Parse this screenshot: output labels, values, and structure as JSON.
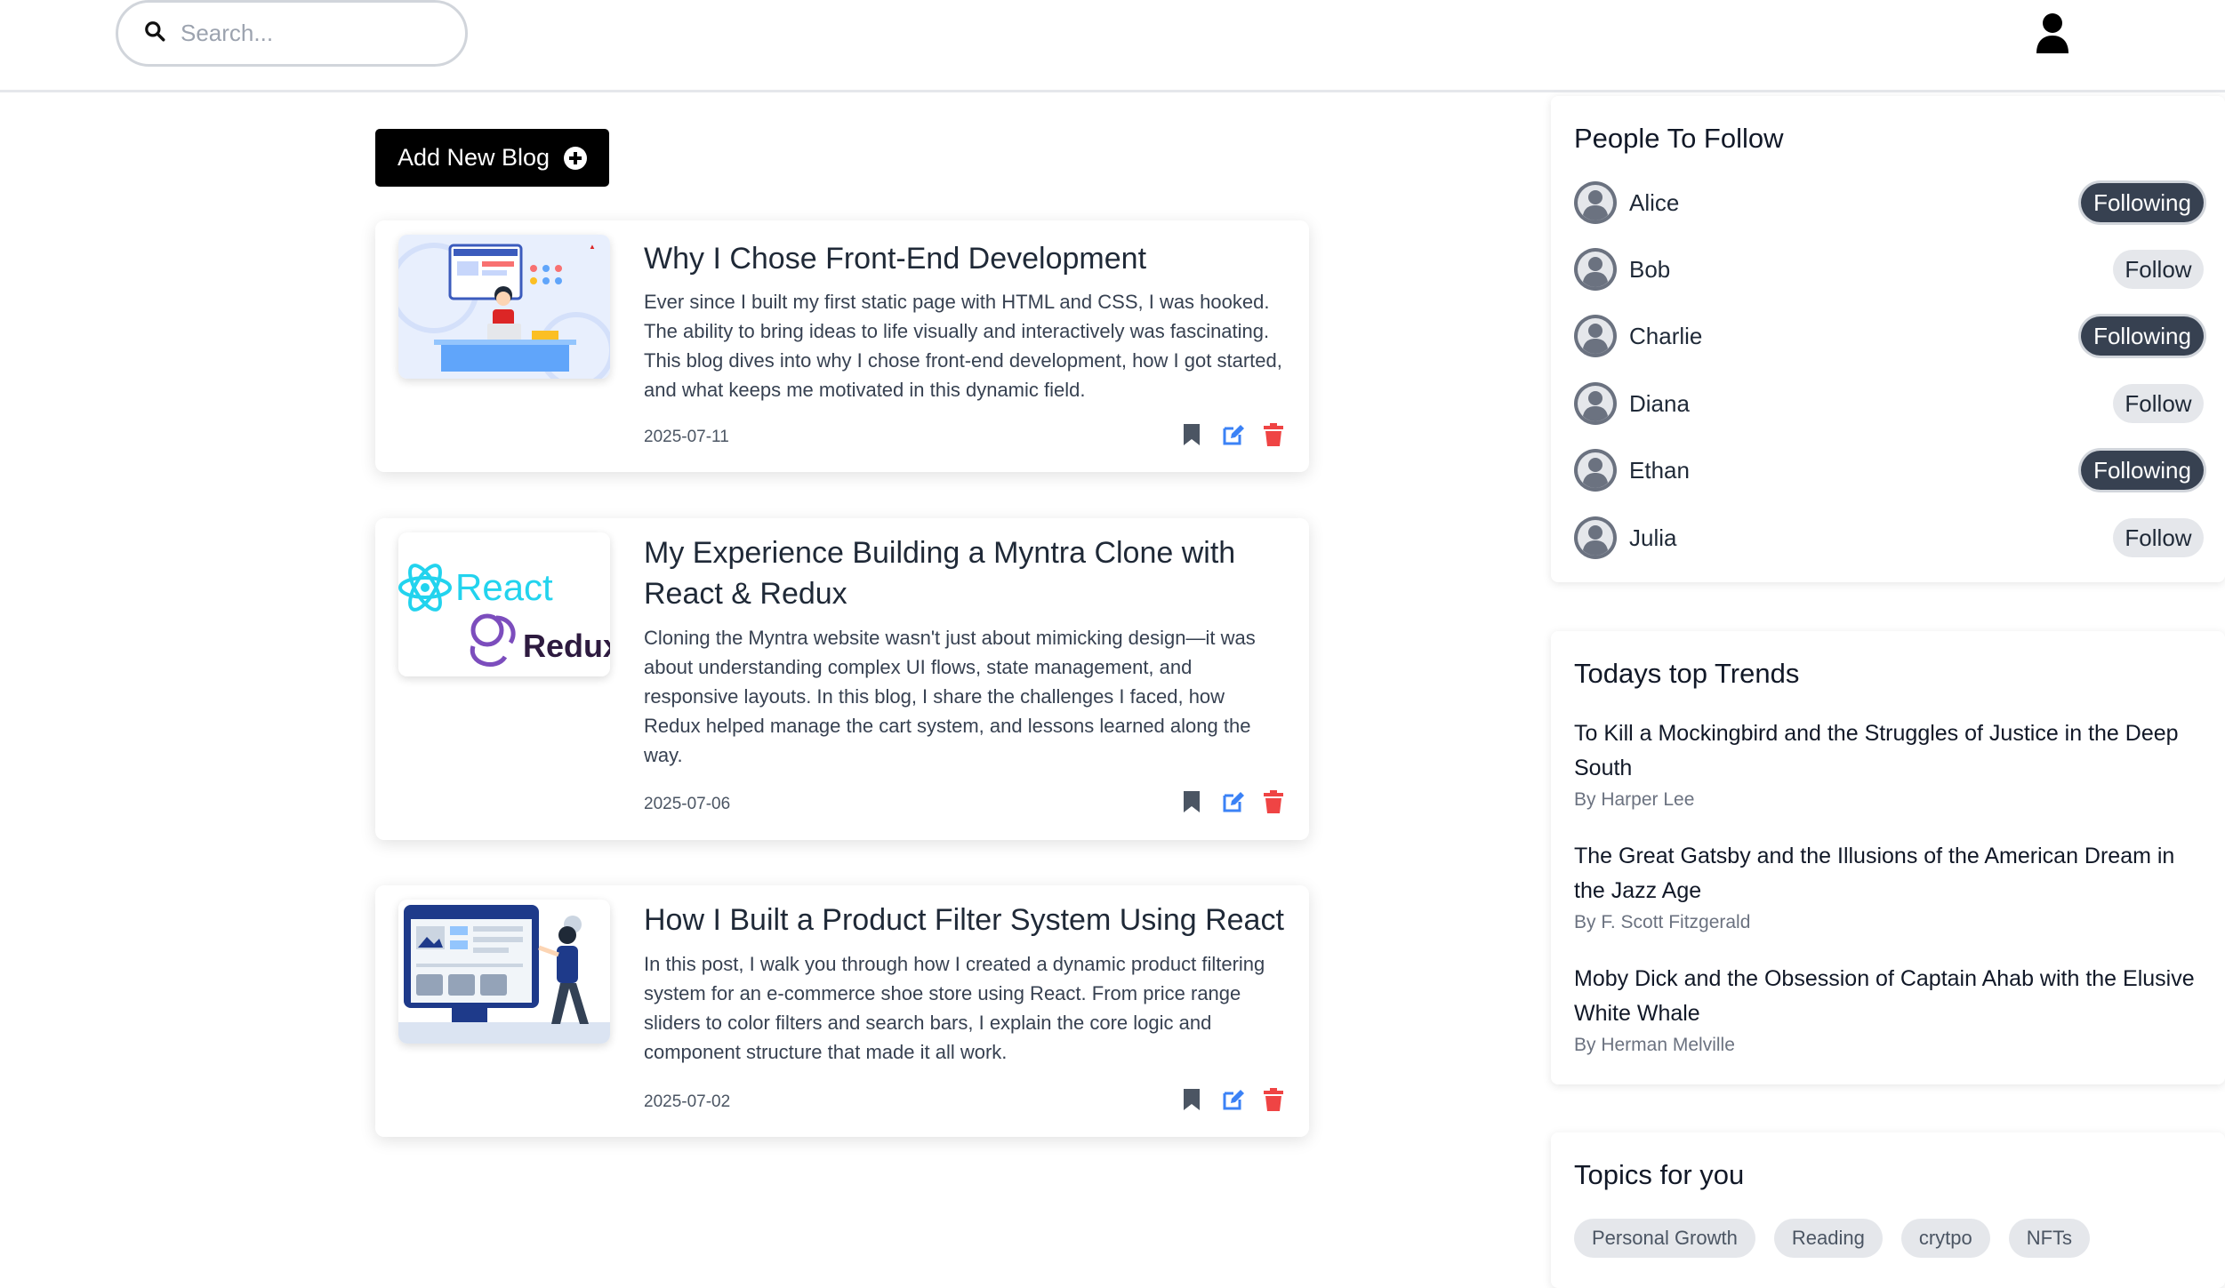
{
  "search": {
    "placeholder": "Search..."
  },
  "header": {
    "user_icon": "user-icon"
  },
  "feed": {
    "add_button_label": "Add New Blog",
    "posts": [
      {
        "title": "Why I Chose Front-End Development",
        "excerpt": "Ever since I built my first static page with HTML and CSS, I was hooked. The ability to bring ideas to life visually and interactively was fascinating. This blog dives into why I chose front-end development, how I got started, and what keeps me motivated in this dynamic field.",
        "date": "2025-07-11",
        "image": "developer-illustration"
      },
      {
        "title": "My Experience Building a Myntra Clone with React & Redux",
        "excerpt": "Cloning the Myntra website wasn't just about mimicking design—it was about understanding complex UI flows, state management, and responsive layouts. In this blog, I share the challenges I faced, how Redux helped manage the cart system, and lessons learned along the way.",
        "date": "2025-07-06",
        "image": "react-redux-logo",
        "logo_text_1": "React",
        "logo_text_2": "Redux"
      },
      {
        "title": "How I Built a Product Filter System Using React",
        "excerpt": "In this post, I walk you through how I created a dynamic product filtering system for an e-commerce shoe store using React. From price range sliders to color filters and search bars, I explain the core logic and component structure that made it all work.",
        "date": "2025-07-02",
        "image": "web-design-illustration"
      }
    ]
  },
  "people": {
    "title": "People To Follow",
    "list": [
      {
        "name": "Alice",
        "status": "Following"
      },
      {
        "name": "Bob",
        "status": "Follow"
      },
      {
        "name": "Charlie",
        "status": "Following"
      },
      {
        "name": "Diana",
        "status": "Follow"
      },
      {
        "name": "Ethan",
        "status": "Following"
      },
      {
        "name": "Julia",
        "status": "Follow"
      }
    ]
  },
  "trends": {
    "title": "Todays top Trends",
    "items": [
      {
        "title": "To Kill a Mockingbird and the Struggles of Justice in the Deep South",
        "author": "By Harper Lee"
      },
      {
        "title": "The Great Gatsby and the Illusions of the American Dream in the Jazz Age",
        "author": "By F. Scott Fitzgerald"
      },
      {
        "title": "Moby Dick and the Obsession of Captain Ahab with the Elusive White Whale",
        "author": "By Herman Melville"
      }
    ]
  },
  "topics": {
    "title": "Topics for you",
    "items": [
      "Personal Growth",
      "Reading",
      "crytpo",
      "NFTs"
    ]
  },
  "colors": {
    "bookmark": "#4b5563",
    "edit": "#3b82f6",
    "delete": "#ef4444",
    "following_bg": "#374151",
    "follow_bg": "#e5e7eb"
  }
}
